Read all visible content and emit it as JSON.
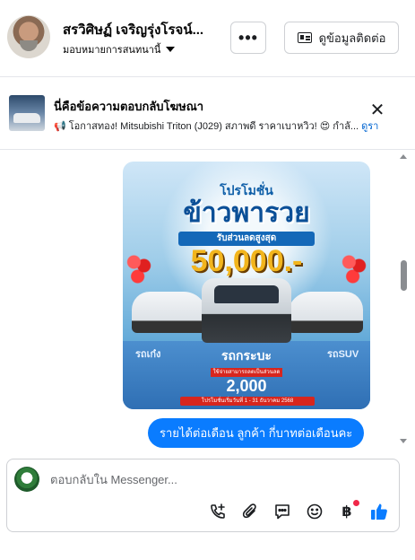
{
  "header": {
    "contact_name": "สรวิศิษฏ์ เจริญรุ่งโรจน์...",
    "assignment_label": "มอบหมายการสนทนานี้",
    "more_label": "•••",
    "details_label": "ดูข้อมูลติดต่อ"
  },
  "ad_reply": {
    "title": "นี่คือข้อความตอบกลับโฆษณา",
    "preview_icons": "📢",
    "preview_text": "โอกาสทอง! Mitsubishi Triton (J029) สภาพดี ราคาเบาหวิว! 😍 กำลั...",
    "more_label": "ดูรา",
    "close_label": "✕"
  },
  "thread": {
    "promo_image": {
      "tagline": "โปรโมชั่น",
      "headline": "ข้าวพารวย",
      "subline": "รับส่วนลดสูงสุด",
      "amount": "50,000.-",
      "label_left": "รถเก๋ง",
      "label_right": "รถSUV",
      "mid_title": "รถกระบะ",
      "red_note": "ใช้จ่ายสามารถลดเป็นส่วนลด",
      "discount": "2,000",
      "date_note": "โปรโมชั่นเริ่มวันที่ 1 - 31 ธันวาคม 2568"
    },
    "outgoing_message": "รายได้ต่อเดือน  ลูกค้า กี่บาทต่อเดือนคะ"
  },
  "composer": {
    "placeholder": "ตอบกลับใน Messenger...",
    "baht_glyph": "฿",
    "tools": [
      "phone-plus-icon",
      "paperclip-icon",
      "quick-reply-icon",
      "emoji-icon",
      "baht-payment-icon",
      "thumbs-up-icon"
    ]
  },
  "colors": {
    "bubble_blue": "#0a7cff",
    "like_blue": "#0a7cff",
    "notify_red": "#f02849",
    "border": "#ced0d4"
  }
}
